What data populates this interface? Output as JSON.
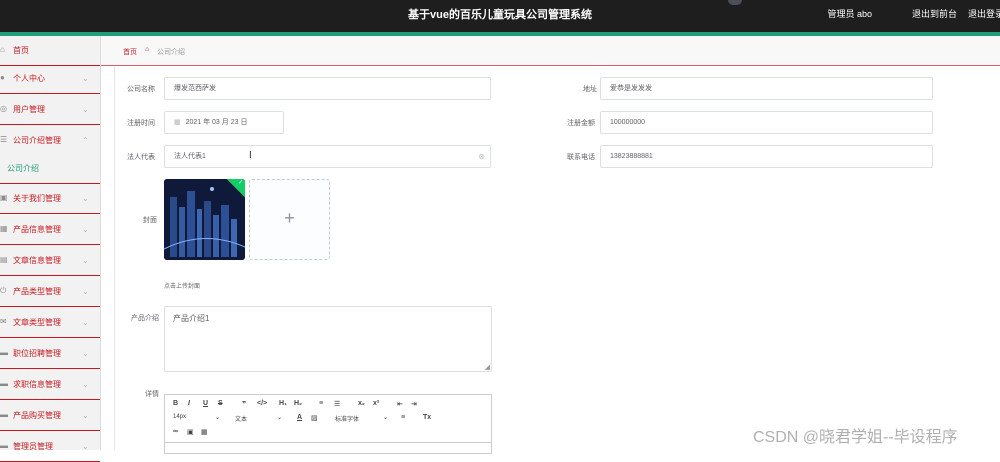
{
  "header": {
    "title": "基于vue的百乐儿童玩具公司管理系统",
    "user": "管理员 abo",
    "front_link": "退出到前台",
    "logout": "退出登录"
  },
  "sidebar": {
    "items": [
      {
        "label": "首页",
        "icon": "home-icon"
      },
      {
        "label": "个人中心",
        "icon": "user-icon"
      },
      {
        "label": "用户管理",
        "icon": "users-icon"
      },
      {
        "label": "公司介绍管理",
        "icon": "list-icon",
        "expanded": true
      },
      {
        "label": "关于我们管理",
        "icon": "info-icon"
      },
      {
        "label": "产品信息管理",
        "icon": "grid-icon"
      },
      {
        "label": "文章信息管理",
        "icon": "doc-icon"
      },
      {
        "label": "产品类型管理",
        "icon": "power-icon"
      },
      {
        "label": "文章类型管理",
        "icon": "mail-icon"
      },
      {
        "label": "职位招聘管理",
        "icon": "monitor-icon"
      },
      {
        "label": "求职信息管理",
        "icon": "monitor-icon"
      },
      {
        "label": "产品购买管理",
        "icon": "monitor-icon"
      },
      {
        "label": "管理员管理",
        "icon": "monitor-icon"
      }
    ],
    "sub_item": "公司介绍"
  },
  "breadcrumb": {
    "home": "首页",
    "current": "公司介绍"
  },
  "form": {
    "company_name": {
      "label": "公司名称",
      "value": "爆发范西萨发"
    },
    "address": {
      "label": "地址",
      "value": "爱恭是发发发"
    },
    "reg_time": {
      "label": "注册时间",
      "value": "2021 年 03 月 23 日"
    },
    "reg_capital": {
      "label": "注册金额",
      "value": "100000000"
    },
    "legal_rep": {
      "label": "法人代表",
      "value": "法人代表1"
    },
    "phone": {
      "label": "联系电话",
      "value": "13823888881"
    },
    "cover": {
      "label": "封面",
      "tip": "点击上传封面"
    },
    "intro": {
      "label": "产品介绍",
      "value": "产品介绍1"
    },
    "detail": {
      "label": "详情"
    }
  },
  "editor": {
    "font_size": "14px",
    "block_type": "文本",
    "font_family": "标准字体"
  },
  "watermark": "CSDN @晓君学姐--毕设程序",
  "colors": {
    "accent": "#c8181e",
    "teal": "#1e9e7a",
    "topbar": "#1e1e1e"
  }
}
